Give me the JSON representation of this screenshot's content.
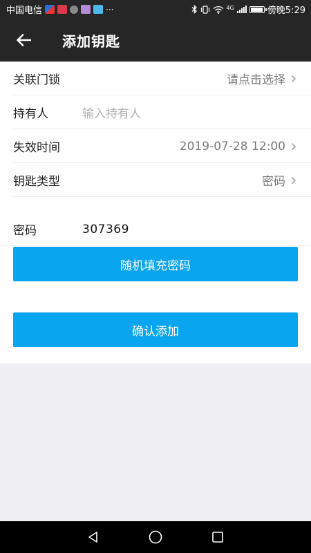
{
  "status_bar": {
    "carrier": "中国电信",
    "more": "···",
    "network": "4G",
    "battery_level": 0.85,
    "time_label": "傍晚5:29"
  },
  "header": {
    "title": "添加钥匙",
    "back_icon": "arrow-left-icon"
  },
  "form": {
    "rows": [
      {
        "label": "关联门锁",
        "value": "请点击选择",
        "has_chevron": true
      },
      {
        "label": "持有人",
        "placeholder": "输入持有人"
      },
      {
        "label": "失效时间",
        "value": "2019-07-28 12:00",
        "has_chevron": true
      },
      {
        "label": "钥匙类型",
        "value": "密码",
        "has_chevron": true
      }
    ],
    "password": {
      "label": "密码",
      "value": "307369"
    }
  },
  "buttons": {
    "random_label": "随机填充密码",
    "confirm_label": "确认添加"
  },
  "colors": {
    "bar_bg": "#262626",
    "accent": "#0aa5ef",
    "page_bg": "#efeff4"
  },
  "nav": {
    "back": "triangle-back-icon",
    "home": "circle-home-icon",
    "recent": "square-recent-icon"
  }
}
